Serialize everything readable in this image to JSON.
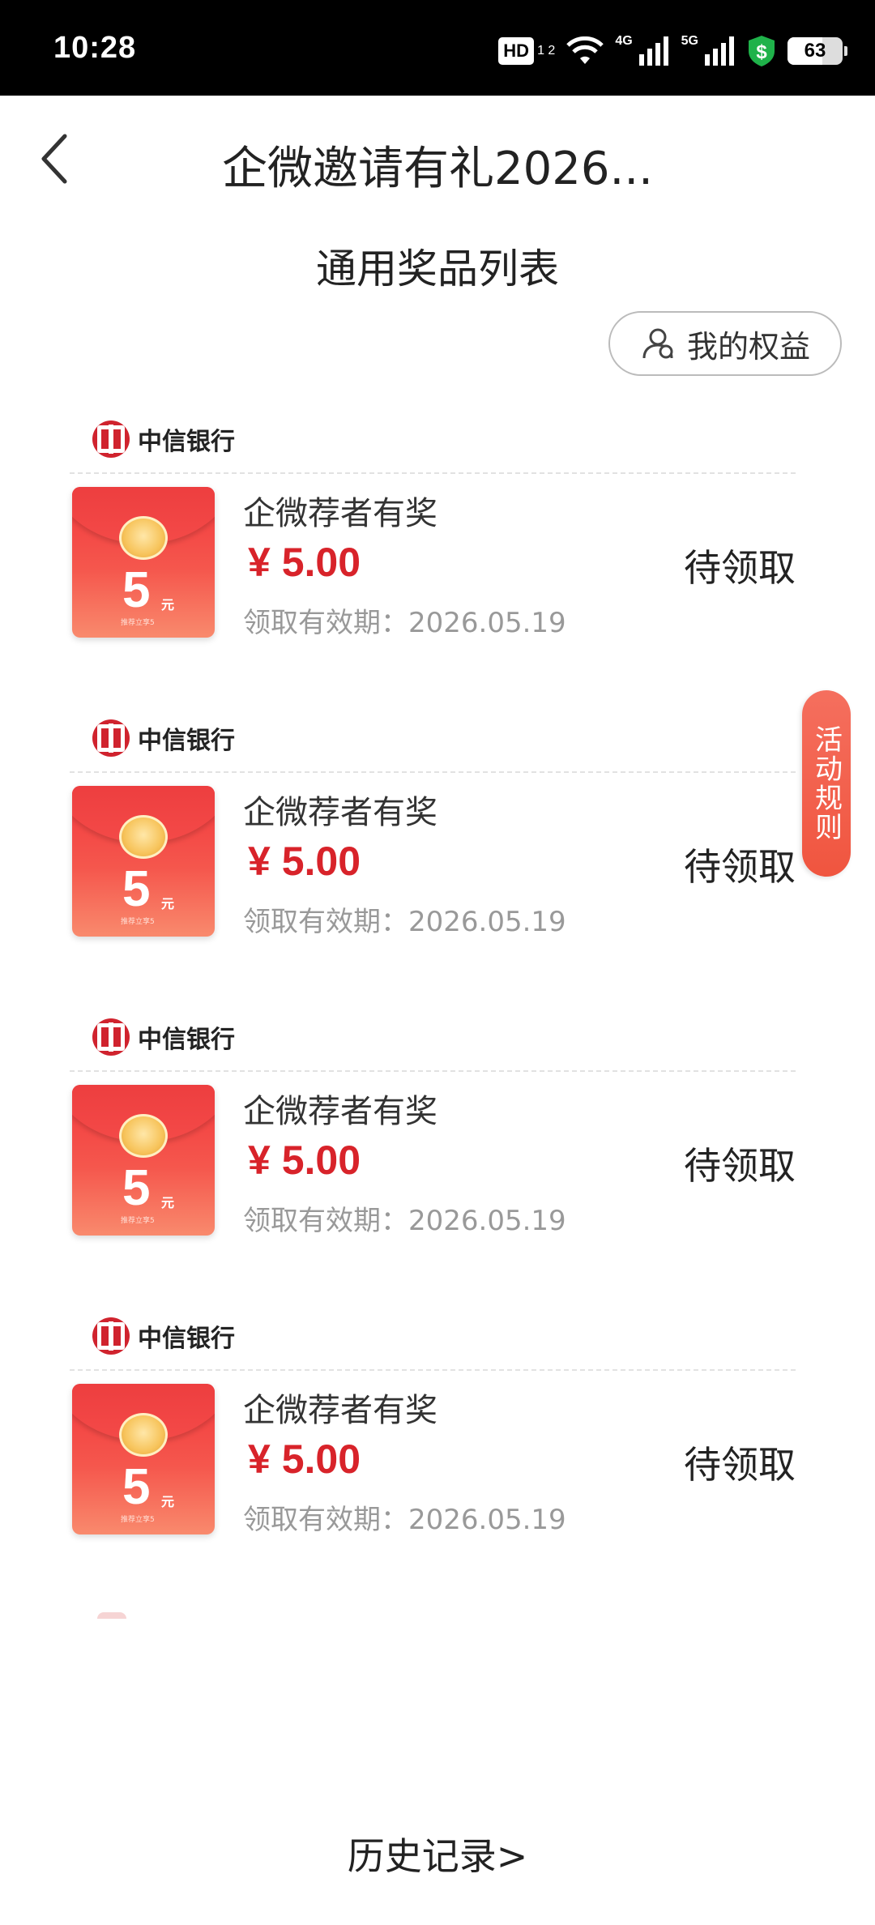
{
  "status_bar": {
    "time": "10:28",
    "hd_label": "HD",
    "hd_sup": "1 2",
    "net1": "4G",
    "net2": "5G",
    "battery": "63",
    "icons": [
      "hd-icon",
      "wifi-icon",
      "signal-4g-icon",
      "signal-5g-icon",
      "shield-dollar-icon",
      "battery-icon"
    ]
  },
  "nav": {
    "title": "企微邀请有礼2026...",
    "back_icon": "chevron-left-icon"
  },
  "section_title": "通用奖品列表",
  "my_benefits": {
    "label": "我的权益",
    "icon": "user-icon"
  },
  "prizes": [
    {
      "bank": "中信银行",
      "name": "企微荐者有奖",
      "price": "¥ 5.00",
      "expiry": "领取有效期：2026.05.19",
      "status": "待领取",
      "envelope_amount": "5",
      "envelope_unit": "元",
      "envelope_note": "推荐立享5"
    },
    {
      "bank": "中信银行",
      "name": "企微荐者有奖",
      "price": "¥ 5.00",
      "expiry": "领取有效期：2026.05.19",
      "status": "待领取",
      "envelope_amount": "5",
      "envelope_unit": "元",
      "envelope_note": "推荐立享5"
    },
    {
      "bank": "中信银行",
      "name": "企微荐者有奖",
      "price": "¥ 5.00",
      "expiry": "领取有效期：2026.05.19",
      "status": "待领取",
      "envelope_amount": "5",
      "envelope_unit": "元",
      "envelope_note": "推荐立享5"
    },
    {
      "bank": "中信银行",
      "name": "企微荐者有奖",
      "price": "¥ 5.00",
      "expiry": "领取有效期：2026.05.19",
      "status": "待领取",
      "envelope_amount": "5",
      "envelope_unit": "元",
      "envelope_note": "推荐立享5"
    }
  ],
  "rules_tab": "活动规则",
  "history_link": "历史记录>",
  "colors": {
    "accent_red": "#d8232a",
    "rules_orange": "#f0553f",
    "bank_red": "#d0232e"
  }
}
